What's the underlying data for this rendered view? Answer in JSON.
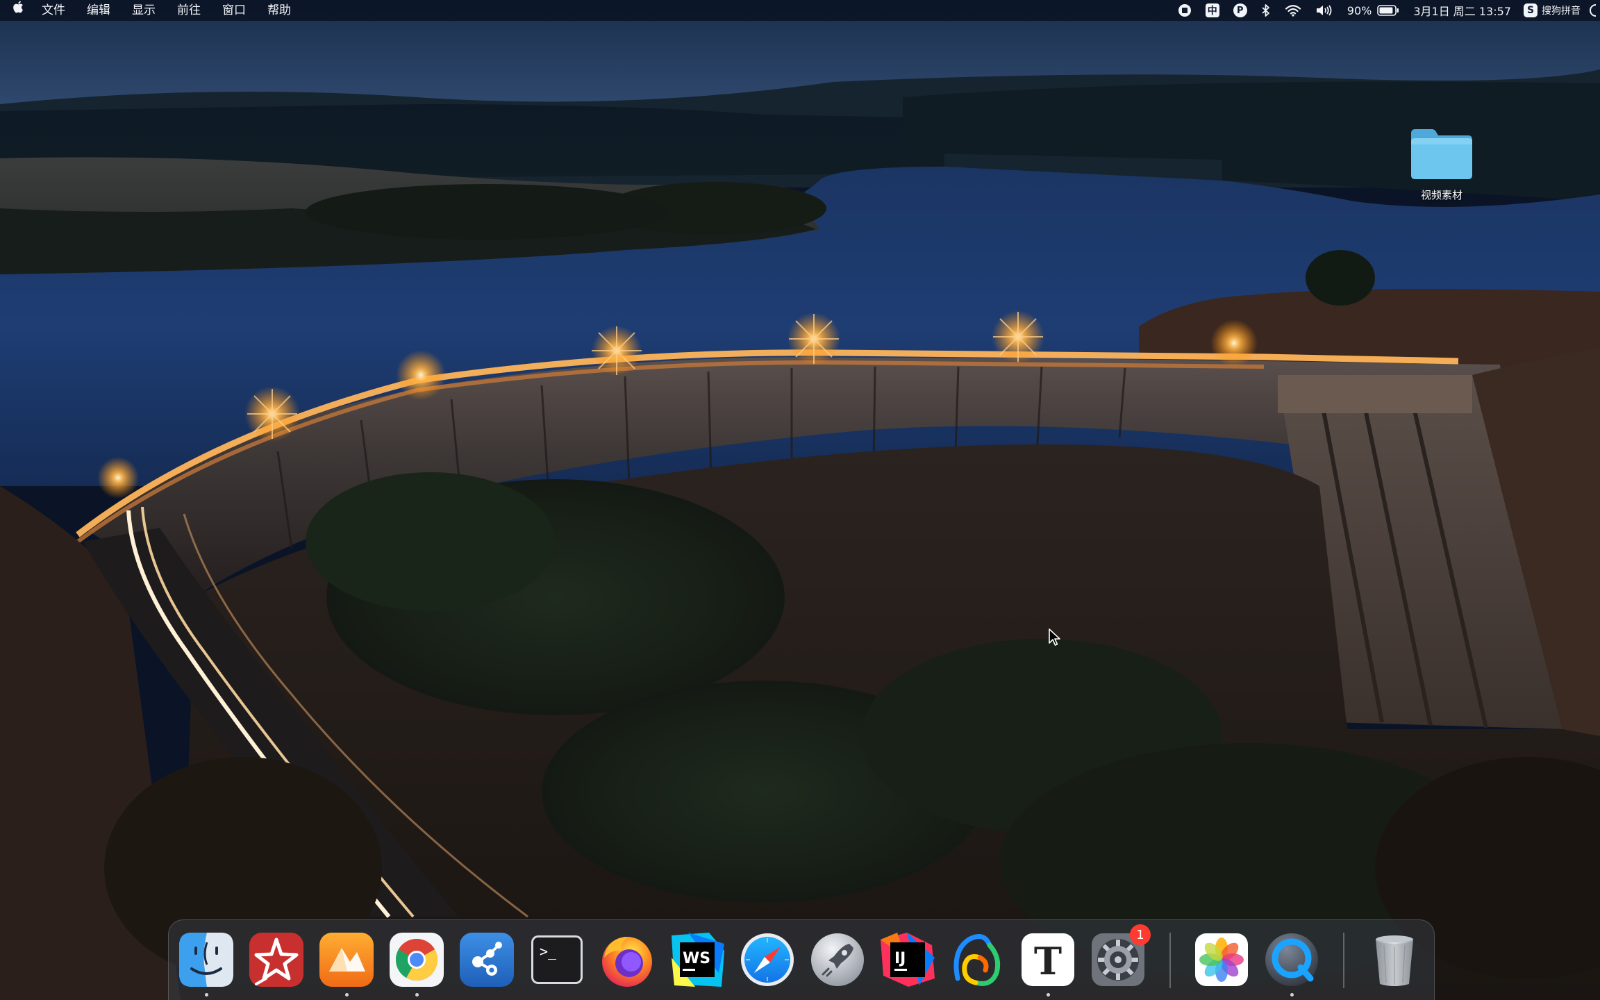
{
  "menubar": {
    "menus": [
      "文件",
      "编辑",
      "显示",
      "前往",
      "窗口",
      "帮助"
    ],
    "status": {
      "record_icon": "screen-record-icon",
      "input_zh": "中",
      "p_label": "P",
      "bluetooth_icon": "bluetooth-icon",
      "wifi_icon": "wifi-icon",
      "volume_icon": "volume-icon",
      "battery_percent": "90%",
      "battery_level": 0.9,
      "datetime": "3月1日 周二 13:57",
      "ime_badge": "S",
      "ime_label": "搜狗拼音"
    }
  },
  "desktop": {
    "folder_label": "视频素材",
    "folder_color": "#6cc6ee"
  },
  "dock": {
    "apps": [
      {
        "name": "Finder",
        "icon": "finder-icon",
        "running": true
      },
      {
        "name": "Spark",
        "icon": "spark-icon",
        "running": false
      },
      {
        "name": "Infuse",
        "icon": "infuse-icon",
        "running": true
      },
      {
        "name": "Google Chrome",
        "icon": "chrome-icon",
        "running": true
      },
      {
        "name": "Sourcetree",
        "icon": "sourcetree-icon",
        "running": false
      },
      {
        "name": "Terminal",
        "icon": "terminal-icon",
        "running": false,
        "text": ">_"
      },
      {
        "name": "Firefox",
        "icon": "firefox-icon",
        "running": false
      },
      {
        "name": "WebStorm",
        "icon": "webstorm-icon",
        "running": false,
        "text": "WS"
      },
      {
        "name": "Safari",
        "icon": "safari-icon",
        "running": false
      },
      {
        "name": "Rocket Typist",
        "icon": "rocket-icon",
        "running": false
      },
      {
        "name": "IntelliJ IDEA",
        "icon": "intellij-icon",
        "running": false,
        "text": "IJ"
      },
      {
        "name": "Nova",
        "icon": "nova-icon",
        "running": false
      },
      {
        "name": "Typora",
        "icon": "typora-icon",
        "running": true,
        "text": "T"
      },
      {
        "name": "System Preferences",
        "icon": "system-preferences-icon",
        "running": false,
        "badge": "1"
      },
      {
        "name": "Photos",
        "icon": "photos-icon",
        "running": false
      },
      {
        "name": "QuickTime Player",
        "icon": "quicktime-icon",
        "running": true
      },
      {
        "name": "Trash",
        "icon": "trash-icon",
        "running": false
      }
    ]
  }
}
